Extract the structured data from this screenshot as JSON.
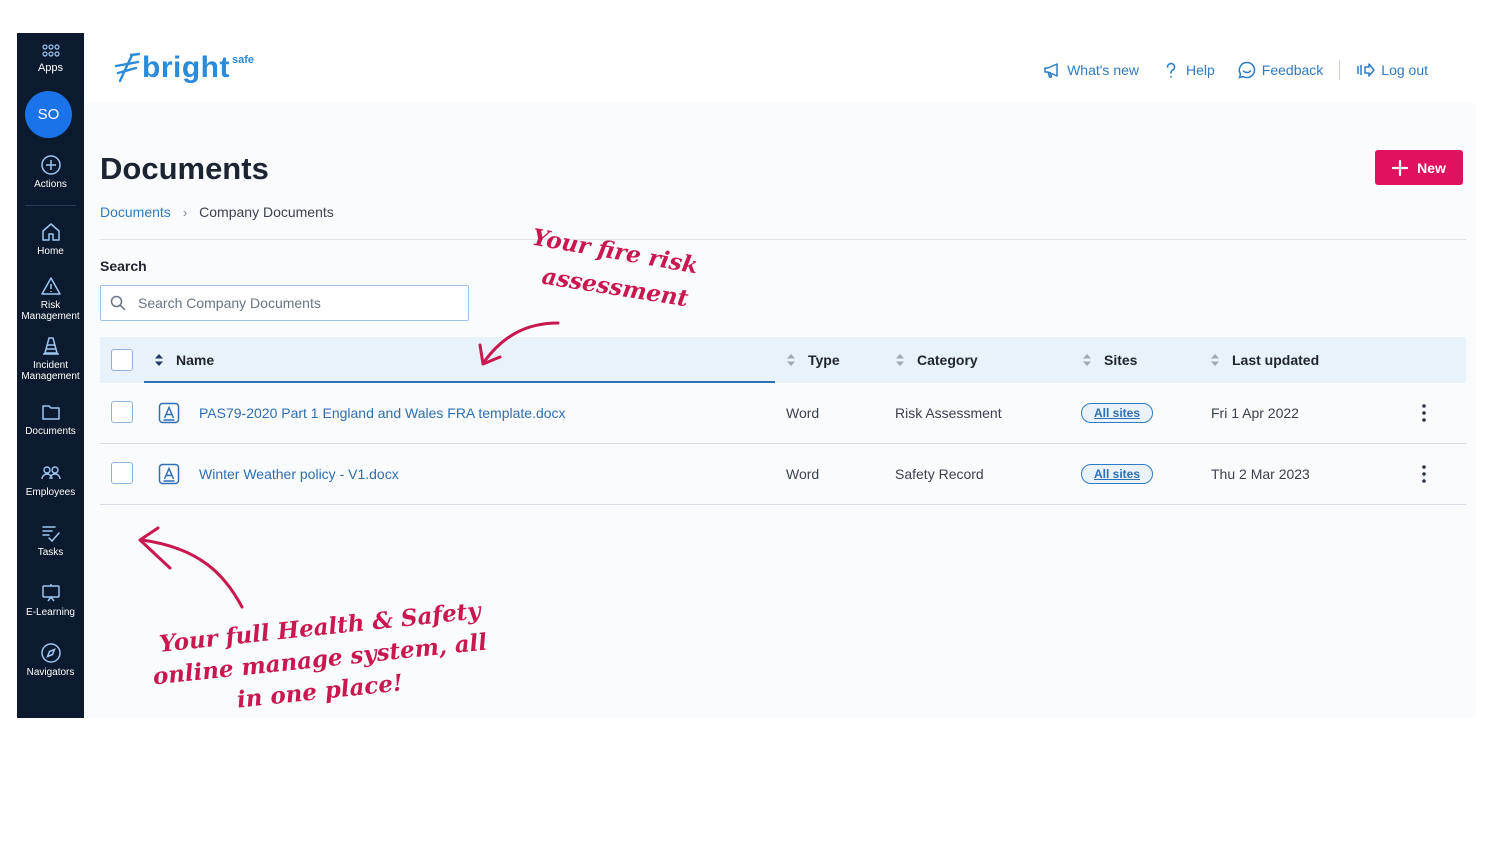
{
  "sidebar": {
    "avatar_initials": "SO",
    "items": [
      {
        "label": "Apps",
        "icon": "apps-grid-icon"
      },
      {
        "label": "Actions",
        "icon": "plus-circle-icon"
      },
      {
        "label": "Home",
        "icon": "home-icon"
      },
      {
        "label": "Risk Management",
        "icon": "warning-triangle-icon"
      },
      {
        "label": "Incident Management",
        "icon": "cone-icon"
      },
      {
        "label": "Documents",
        "icon": "folder-icon"
      },
      {
        "label": "Employees",
        "icon": "people-icon"
      },
      {
        "label": "Tasks",
        "icon": "tasks-icon"
      },
      {
        "label": "E-Learning",
        "icon": "presentation-icon"
      },
      {
        "label": "Navigators",
        "icon": "compass-icon"
      }
    ]
  },
  "header": {
    "logo_text": "bright",
    "logo_superscript": "safe",
    "links": {
      "whats_new": "What's new",
      "help": "Help",
      "feedback": "Feedback",
      "logout": "Log out"
    }
  },
  "page": {
    "title": "Documents",
    "new_button": "New",
    "breadcrumb": {
      "root": "Documents",
      "current": "Company Documents"
    },
    "search": {
      "label": "Search",
      "placeholder": "Search Company Documents"
    }
  },
  "table": {
    "columns": {
      "name": "Name",
      "type": "Type",
      "category": "Category",
      "sites": "Sites",
      "updated": "Last updated"
    },
    "rows": [
      {
        "name": "PAS79-2020 Part 1 England and Wales FRA template.docx",
        "type": "Word",
        "category": "Risk Assessment",
        "sites": "All sites",
        "updated": "Fri 1 Apr 2022"
      },
      {
        "name": "Winter Weather policy - V1.docx",
        "type": "Word",
        "category": "Safety Record",
        "sites": "All sites",
        "updated": "Thu 2 Mar 2023"
      }
    ]
  },
  "annotations": {
    "fire_line1": "Your fire risk",
    "fire_line2": "assessment",
    "hs_line1": "Your full Health & Safety",
    "hs_line2": "online manage system, all",
    "hs_line3": "in one place!"
  },
  "colors": {
    "sidebar_bg": "#0b1a2e",
    "accent_blue": "#2e7bc4",
    "new_button": "#e0115f",
    "annotation": "#c8184f"
  }
}
